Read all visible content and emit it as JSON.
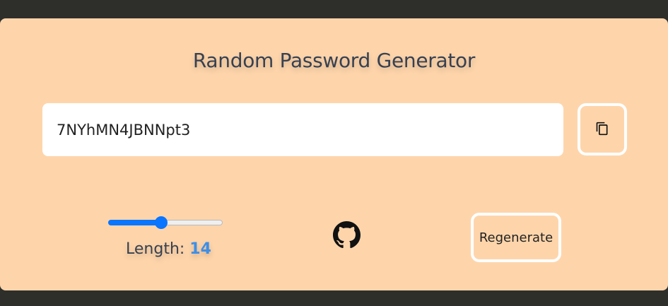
{
  "app": {
    "title": "Random Password Generator"
  },
  "password": {
    "value": "7NYhMN4JBNNpt3"
  },
  "copy_button": {
    "icon": "copy-icon"
  },
  "length": {
    "label": "Length:",
    "value": "14",
    "slider_fraction": 0.46
  },
  "github": {
    "icon": "github-icon"
  },
  "regenerate": {
    "label": "Regenerate"
  },
  "colors": {
    "background": "#2e2f2b",
    "card": "#fed5ab",
    "accent": "#0a75ff",
    "length_value": "#3d8fe8",
    "title_text": "#374151"
  }
}
